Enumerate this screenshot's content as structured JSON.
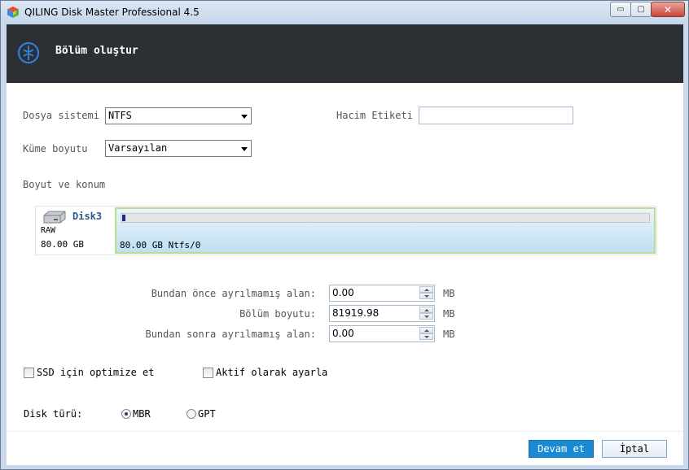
{
  "window": {
    "title": "QILING Disk Master Professional 4.5",
    "controls": {
      "minimize": "▭",
      "maximize": "▢",
      "close": "✕"
    }
  },
  "header": {
    "title": "Bölüm oluştur",
    "icon": "qiling-logo-icon"
  },
  "form": {
    "file_system": {
      "label": "Dosya sistemi",
      "value": "NTFS"
    },
    "cluster_size": {
      "label": "Küme boyutu",
      "value": "Varsayılan"
    },
    "volume_label": {
      "label": "Hacim Etiketi",
      "value": ""
    }
  },
  "size_location": {
    "label": "Boyut ve konum",
    "disk": {
      "name": "Disk3",
      "type": "RAW",
      "size": "80.00 GB",
      "icon": "hard-disk-icon"
    },
    "partition": {
      "label": "80.00 GB Ntfs/0",
      "used_fraction": 0.006
    }
  },
  "spinners": [
    {
      "label": "Bundan önce ayrılmamış alan:",
      "value": "0.00",
      "unit": "MB"
    },
    {
      "label": "Bölüm boyutu:",
      "value": "81919.98",
      "unit": "MB"
    },
    {
      "label": "Bundan sonra ayrılmamış alan:",
      "value": "0.00",
      "unit": "MB"
    }
  ],
  "options": {
    "ssd_optimize": {
      "label": "SSD için optimize et",
      "checked": false
    },
    "set_active": {
      "label": "Aktif olarak ayarla",
      "checked": false
    }
  },
  "disk_type": {
    "label": "Disk türü:",
    "options": [
      {
        "label": "MBR",
        "selected": true
      },
      {
        "label": "GPT",
        "selected": false
      }
    ]
  },
  "buttons": {
    "next": "Devam et",
    "cancel": "İptal"
  },
  "colors": {
    "header_bg": "#2c2f33",
    "primary_button": "#1b8ad4",
    "partition_border": "#b8dd8e"
  }
}
